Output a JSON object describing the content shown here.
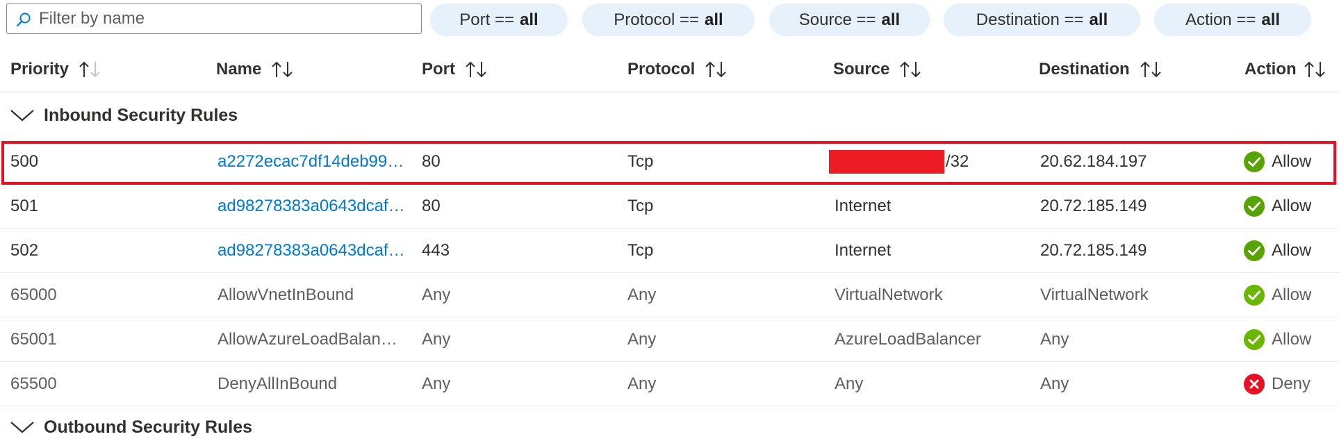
{
  "filter": {
    "placeholder": "Filter by name",
    "pills": [
      {
        "label": "Port ==",
        "value": "all"
      },
      {
        "label": "Protocol ==",
        "value": "all"
      },
      {
        "label": "Source ==",
        "value": "all"
      },
      {
        "label": "Destination ==",
        "value": "all"
      },
      {
        "label": "Action ==",
        "value": "all"
      }
    ]
  },
  "columns": [
    "Priority",
    "Name",
    "Port",
    "Protocol",
    "Source",
    "Destination",
    "Action"
  ],
  "groups": {
    "inbound": "Inbound Security Rules",
    "outbound": "Outbound Security Rules"
  },
  "rows": [
    {
      "priority": "500",
      "name": "a2272ecac7df14deb99…",
      "port": "80",
      "protocol": "Tcp",
      "source": "/32",
      "destination": "20.62.184.197",
      "action": "Allow"
    },
    {
      "priority": "501",
      "name": "ad98278383a0643dcaf…",
      "port": "80",
      "protocol": "Tcp",
      "source": "Internet",
      "destination": "20.72.185.149",
      "action": "Allow"
    },
    {
      "priority": "502",
      "name": "ad98278383a0643dcaf…",
      "port": "443",
      "protocol": "Tcp",
      "source": "Internet",
      "destination": "20.72.185.149",
      "action": "Allow"
    },
    {
      "priority": "65000",
      "name": "AllowVnetInBound",
      "port": "Any",
      "protocol": "Any",
      "source": "VirtualNetwork",
      "destination": "VirtualNetwork",
      "action": "Allow"
    },
    {
      "priority": "65001",
      "name": "AllowAzureLoadBalan…",
      "port": "Any",
      "protocol": "Any",
      "source": "AzureLoadBalancer",
      "destination": "Any",
      "action": "Allow"
    },
    {
      "priority": "65500",
      "name": "DenyAllInBound",
      "port": "Any",
      "protocol": "Any",
      "source": "Any",
      "destination": "Any",
      "action": "Deny"
    }
  ],
  "icons": {
    "search": "search-icon",
    "sort": "sort-arrows-icon",
    "chevron": "chevron-down-icon",
    "allow": "check-circle-icon",
    "deny": "x-circle-icon"
  },
  "colors": {
    "link": "#0078d4",
    "allow": "#57a300",
    "allow_default": "#6bb700",
    "deny": "#e81123",
    "highlight": "#e81123",
    "pill_bg": "#e6f1fb"
  }
}
